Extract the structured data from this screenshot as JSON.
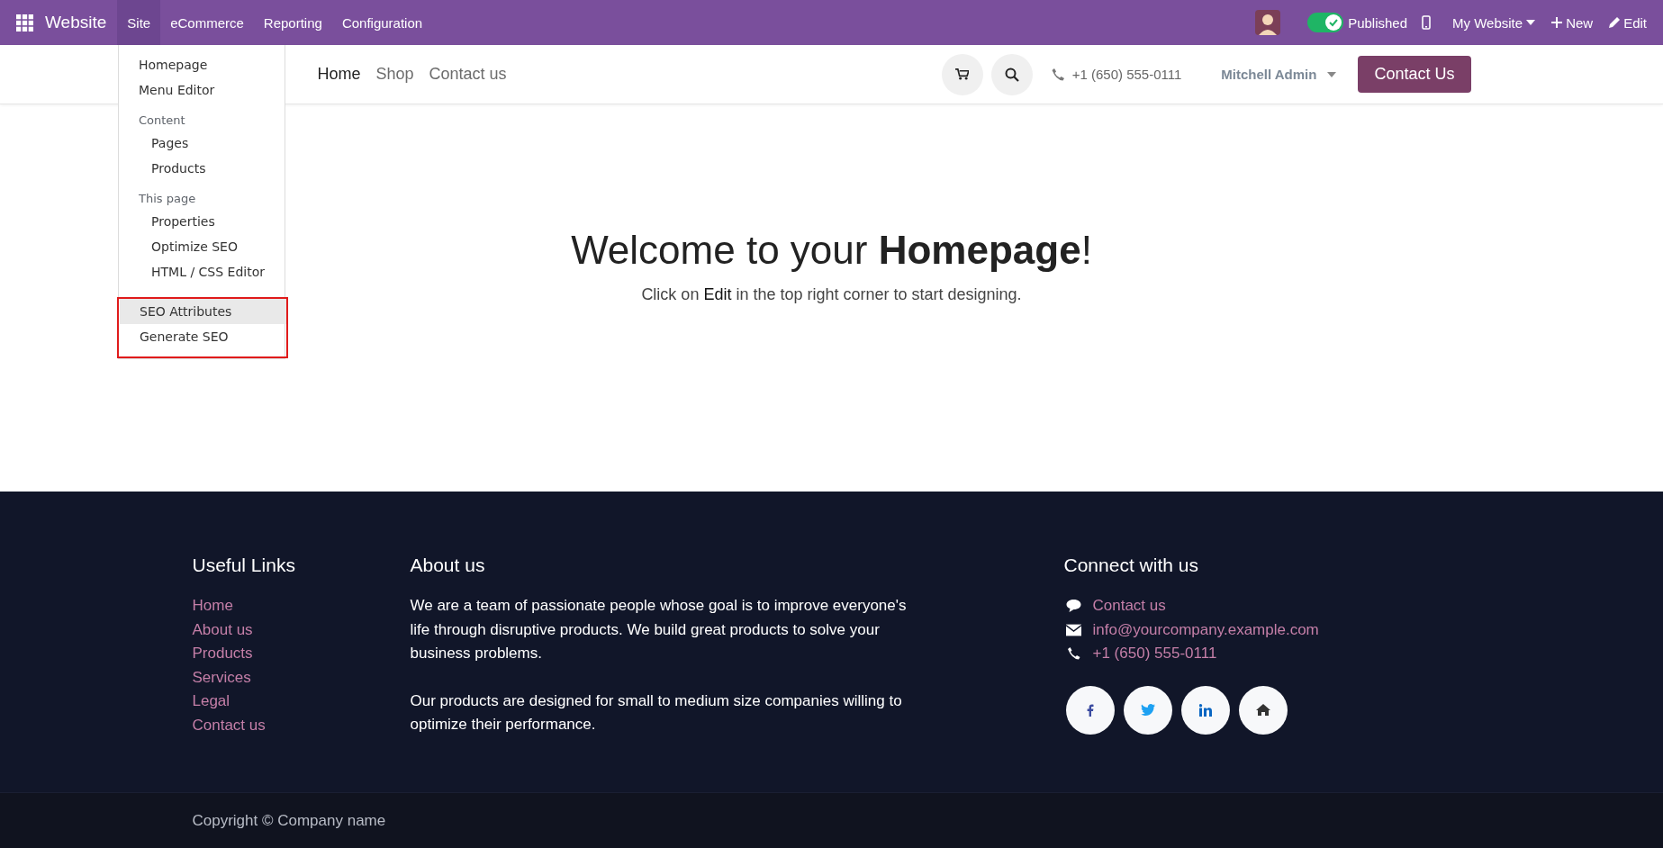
{
  "topbar": {
    "app_name": "Website",
    "menus": [
      {
        "label": "Site",
        "selected": true
      },
      {
        "label": "eCommerce",
        "selected": false
      },
      {
        "label": "Reporting",
        "selected": false
      },
      {
        "label": "Configuration",
        "selected": false
      }
    ],
    "published": {
      "label": "Published",
      "on": true
    },
    "website": "My Website",
    "new": "New",
    "edit": "Edit"
  },
  "site_menu": {
    "entries": [
      {
        "kind": "item",
        "label": "Homepage",
        "selected": false
      },
      {
        "kind": "item",
        "label": "Menu Editor",
        "selected": false
      },
      {
        "kind": "section",
        "label": "Content",
        "children": [
          {
            "label": "Pages",
            "selected": false
          },
          {
            "label": "Products",
            "selected": false
          }
        ]
      },
      {
        "kind": "section",
        "label": "This page",
        "children": [
          {
            "label": "Properties",
            "selected": false
          },
          {
            "label": "Optimize SEO",
            "selected": false
          },
          {
            "label": "HTML / CSS Editor",
            "selected": false
          }
        ]
      },
      {
        "kind": "boxed",
        "children": [
          {
            "label": "SEO Attributes",
            "selected": true
          },
          {
            "label": "Generate SEO",
            "selected": false
          }
        ]
      }
    ]
  },
  "header": {
    "nav": [
      {
        "label": "Home",
        "selected": true
      },
      {
        "label": "Shop",
        "selected": false
      },
      {
        "label": "Contact us",
        "selected": false
      }
    ],
    "phone": "+1 (650) 555-0111",
    "user": "Mitchell Admin",
    "cta": "Contact Us"
  },
  "hero": {
    "title": "Welcome to your **Homepage**!",
    "subtitle": "Click on **Edit** in the top right corner to start designing."
  },
  "footer": {
    "useful_links": {
      "title": "Useful Links",
      "links": [
        "Home",
        "About us",
        "Products",
        "Services",
        "Legal",
        "Contact us"
      ]
    },
    "about": {
      "title": "About us",
      "paragraphs": [
        "We are a team of passionate people whose goal is to improve everyone's life through disruptive products. We build great products to solve your business problems.",
        "Our products are designed for small to medium size companies willing to optimize their performance."
      ]
    },
    "connect": {
      "title": "Connect with us",
      "items": [
        {
          "kind": "chat",
          "label": "Contact us"
        },
        {
          "kind": "email",
          "label": "info@yourcompany.example.com"
        },
        {
          "kind": "phone",
          "label": "+1 (650) 555-0111"
        }
      ],
      "social": [
        {
          "kind": "facebook"
        },
        {
          "kind": "twitter"
        },
        {
          "kind": "linkedin"
        },
        {
          "kind": "home"
        }
      ]
    },
    "copyright": "Copyright © Company name"
  }
}
